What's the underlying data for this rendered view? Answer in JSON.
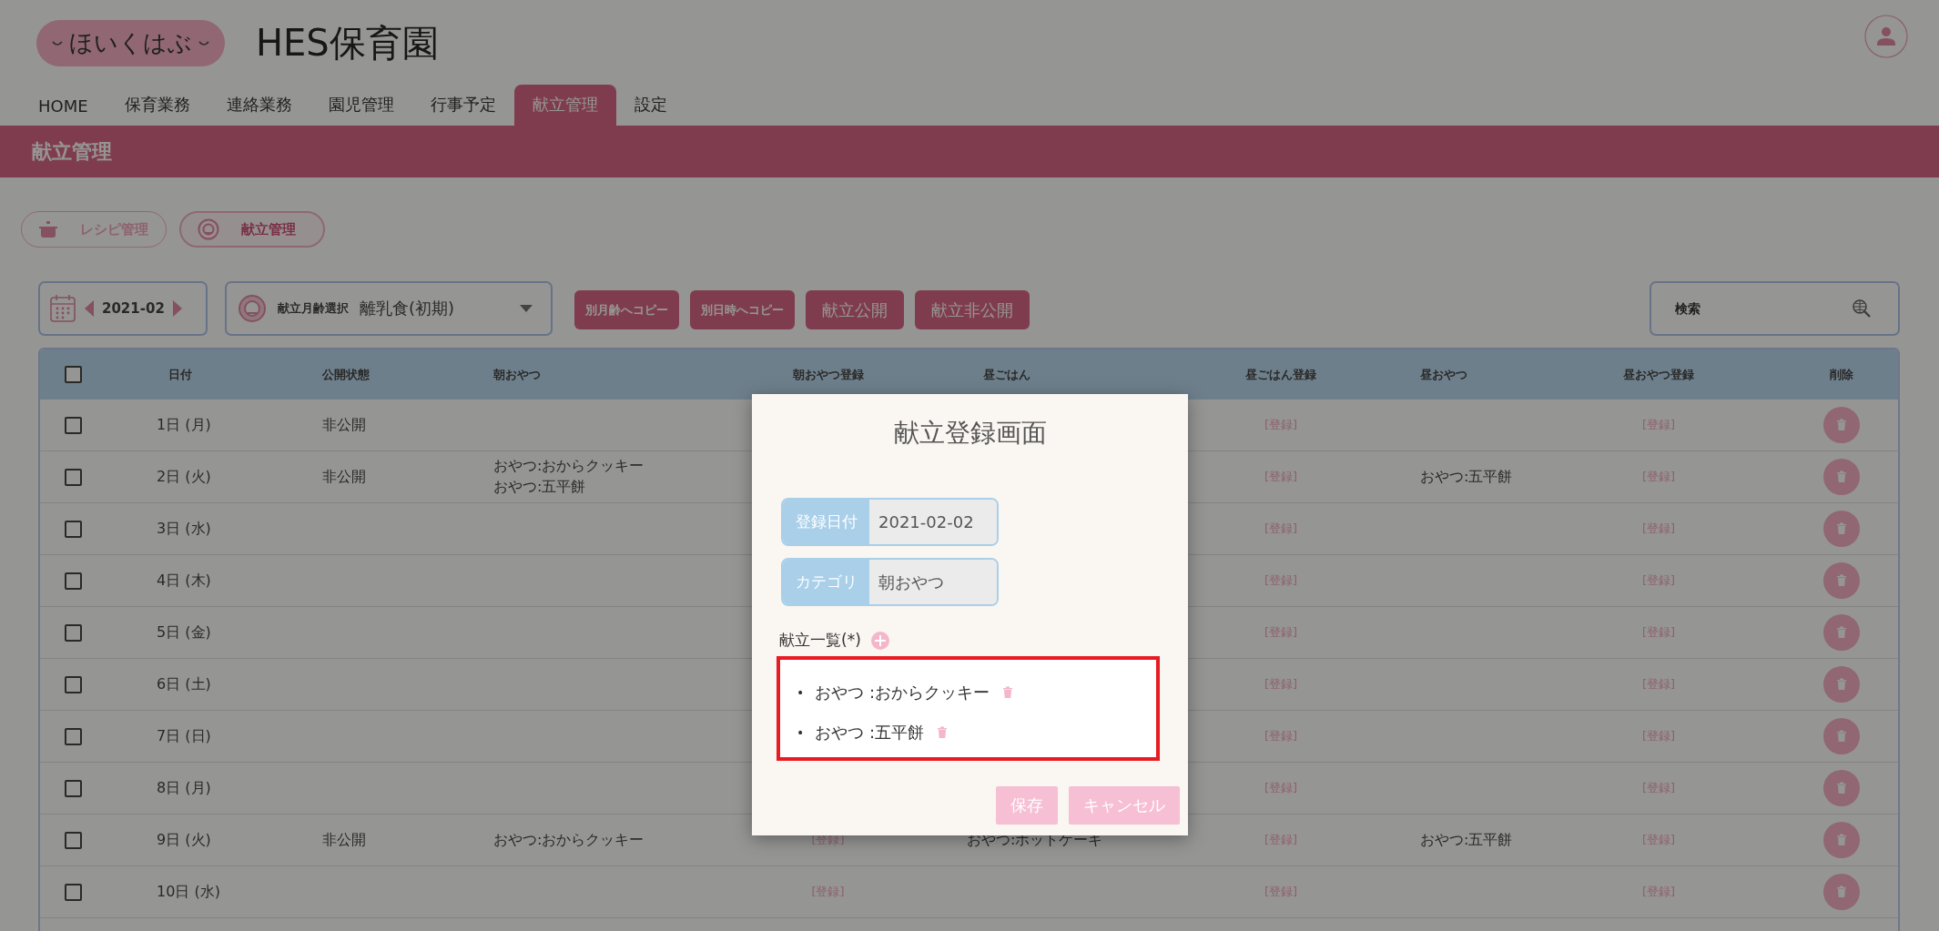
{
  "header": {
    "logo": "ほいくはぶ",
    "site_title": "HES保育園"
  },
  "nav": [
    {
      "label": "HOME",
      "selected": false
    },
    {
      "label": "保育業務",
      "selected": false
    },
    {
      "label": "連絡業務",
      "selected": false
    },
    {
      "label": "園児管理",
      "selected": false
    },
    {
      "label": "行事予定",
      "selected": false
    },
    {
      "label": "献立管理",
      "selected": true
    },
    {
      "label": "設定",
      "selected": false
    }
  ],
  "page_title": "献立管理",
  "mode_buttons": [
    {
      "kind": "pot",
      "label": "レシピ管理",
      "selected": false
    },
    {
      "kind": "chef",
      "label": "献立管理",
      "selected": true
    }
  ],
  "month_picker": {
    "value": "2021-02"
  },
  "age_select": {
    "label": "献立月齢選択",
    "value": "離乳食(初期)"
  },
  "actions": [
    {
      "label": "別月齢へコピー",
      "kind": "small"
    },
    {
      "label": "別日時へコピー",
      "kind": "small"
    },
    {
      "label": "献立公開",
      "kind": "large"
    },
    {
      "label": "献立非公開",
      "kind": "large"
    }
  ],
  "search": {
    "placeholder": "検索"
  },
  "table": {
    "all_checked": false,
    "columns": [
      "日付",
      "公開状態",
      "朝おやつ",
      "朝おやつ登録",
      "昼ごはん",
      "昼ごはん登録",
      "昼おやつ",
      "昼おやつ登録",
      "削除"
    ],
    "rows": [
      {
        "checked": false,
        "date": "1日 (月)",
        "status": "非公開",
        "lunch_reg": "[登録]",
        "snack_reg": "[登録]"
      },
      {
        "checked": false,
        "date": "2日 (火)",
        "status": "非公開",
        "morning": [
          "おやつ:おからクッキー",
          "おやつ:五平餅"
        ],
        "lunch_reg": "[登録]",
        "snack": "おやつ:五平餅",
        "snack_reg": "[登録]"
      },
      {
        "checked": false,
        "date": "3日 (水)",
        "lunch_reg": "[登録]",
        "snack_reg": "[登録]"
      },
      {
        "checked": false,
        "date": "4日 (木)",
        "lunch_reg": "[登録]",
        "snack_reg": "[登録]"
      },
      {
        "checked": false,
        "date": "5日 (金)",
        "lunch_reg": "[登録]",
        "snack_reg": "[登録]"
      },
      {
        "checked": false,
        "date": "6日 (土)",
        "lunch_reg": "[登録]",
        "snack_reg": "[登録]"
      },
      {
        "checked": false,
        "date": "7日 (日)",
        "lunch_reg": "[登録]",
        "snack_reg": "[登録]"
      },
      {
        "checked": false,
        "date": "8日 (月)",
        "lunch_reg": "[登録]",
        "snack_reg": "[登録]"
      },
      {
        "checked": false,
        "date": "9日 (火)",
        "status": "非公開",
        "morning": [
          "おやつ:おからクッキー"
        ],
        "morning_reg": "[登録]",
        "lunch": "おやつ:ホットケーキ",
        "lunch_reg": "[登録]",
        "snack": "おやつ:五平餅",
        "snack_reg": "[登録]"
      },
      {
        "checked": false,
        "date": "10日 (水)",
        "morning_reg": "[登録]",
        "lunch_reg": "[登録]",
        "snack_reg": "[登録]"
      }
    ]
  },
  "modal": {
    "title": "献立登録画面",
    "fields": [
      {
        "label": "登録日付",
        "value": "2021-02-02"
      },
      {
        "label": "カテゴリ",
        "value": "朝おやつ"
      }
    ],
    "list_label": "献立一覧(*)",
    "items": [
      {
        "bullet": "•",
        "text": "おやつ :おからクッキー"
      },
      {
        "bullet": "•",
        "text": "おやつ :五平餅"
      }
    ],
    "buttons": [
      "保存",
      "キャンセル"
    ]
  }
}
